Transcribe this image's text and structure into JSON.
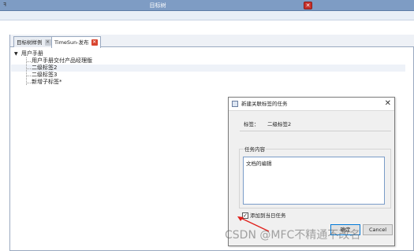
{
  "window": {
    "title": "目标树",
    "close_glyph": "✕",
    "logo_glyph": "ꟻ"
  },
  "tabs": [
    {
      "label": "目标树样例",
      "close_glyph": "✕"
    },
    {
      "label": "TimeSun-发布",
      "close_glyph": "✕"
    }
  ],
  "tree": {
    "expander_glyph": "▼",
    "root": "用户手册",
    "children": [
      "用户手册交付产品经理版",
      "二级标签2",
      "二级标签3",
      "新增子标签*"
    ]
  },
  "dialog": {
    "title": "新建关联标签的任务",
    "close_glyph": "✕",
    "tag_label": "标签：",
    "tag_value": "二级标签2",
    "group_label": "任务内容",
    "content": "文档的编辑",
    "checkbox_checked": true,
    "checkbox_glyph": "✓",
    "checkbox_label": "添加到当日任务",
    "ok_label": "确定",
    "cancel_label": "Cancel"
  },
  "annotation": {
    "arrow_color": "#e0201b"
  },
  "watermark": "CSDN @MFC不精通不改名"
}
